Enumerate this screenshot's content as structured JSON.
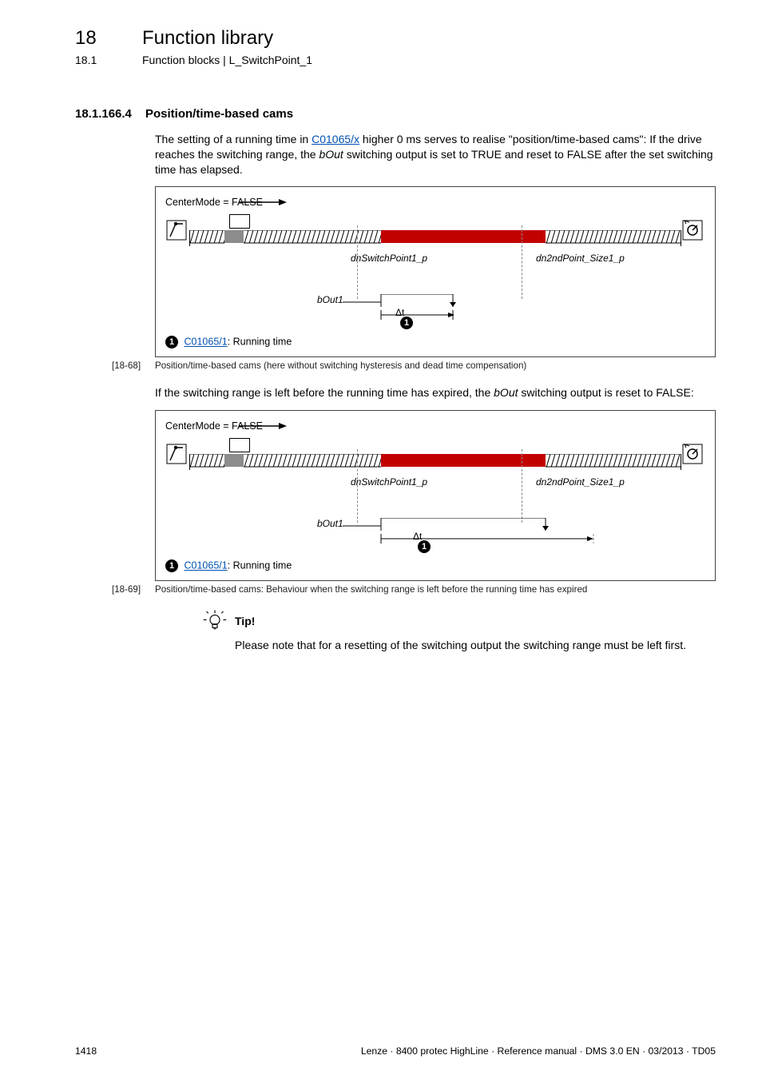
{
  "header": {
    "chapter_num": "18",
    "chapter_title": "Function library",
    "section_num": "18.1",
    "section_title": "Function blocks | L_SwitchPoint_1"
  },
  "rule": "_ _ _ _ _ _ _ _ _ _ _ _ _ _ _ _ _ _ _ _ _ _ _ _ _ _ _ _ _ _ _ _ _ _ _ _ _ _ _ _ _ _ _ _ _ _ _ _ _ _ _ _ _ _ _ _ _ _ _ _ _ _ _ _",
  "section": {
    "num": "18.1.166.4",
    "title": "Position/time-based cams",
    "para1_a": "The setting of a running time in ",
    "para1_link": "C01065/x",
    "para1_b": " higher 0 ms serves to realise \"position/time-based cams\": If the drive reaches the switching range, the ",
    "para1_var": "bOut",
    "para1_c": " switching output is set to TRUE and reset to FALSE after the set switching time has elapsed.",
    "para2_a": "If the switching range is left before the running time has expired, the ",
    "para2_var": "bOut",
    "para2_b": " switching output is reset to FALSE:"
  },
  "diagram": {
    "center_mode": "CenterMode = FALSE",
    "sp1_label": "dnSwitchPoint1_p",
    "sp2_label": "dn2ndPoint_Size1_p",
    "bout_label": "bOut1",
    "dt": "Δt",
    "bubble": "❶",
    "legend_bubble": "❶",
    "legend_link": "C01065/1",
    "legend_text": ": Running time"
  },
  "fig1": {
    "tag": "[18-68]",
    "text": "Position/time-based cams (here without switching hysteresis and dead time compensation)"
  },
  "fig2": {
    "tag": "[18-69]",
    "text": "Position/time-based cams: Behaviour when the switching range is left before the running time has expired"
  },
  "tip": {
    "label": "Tip!",
    "text": "Please note that for a resetting of the switching output the switching range must be left first."
  },
  "footer": {
    "page": "1418",
    "meta": "Lenze · 8400 protec HighLine · Reference manual · DMS 3.0 EN · 03/2013 · TD05"
  }
}
